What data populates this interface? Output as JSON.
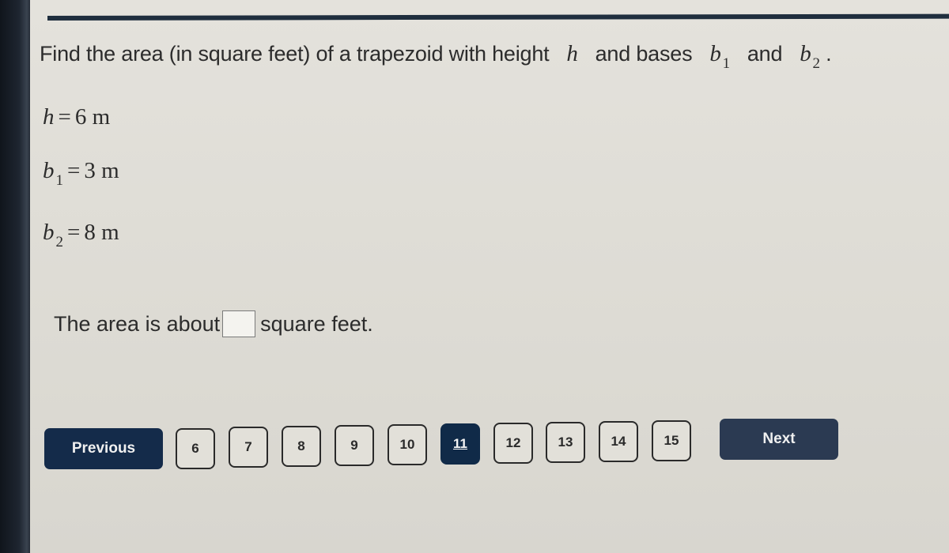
{
  "question": {
    "prefix": "Find the area (in square feet) of a trapezoid with height",
    "var_h": "h",
    "mid": "and bases",
    "var_b": "b",
    "sub_1": "1",
    "and": "and",
    "sub_2": "2",
    "end": "."
  },
  "given": {
    "h": {
      "var": "h",
      "sub": "",
      "eq": "=",
      "value": "6 m"
    },
    "b1": {
      "var": "b",
      "sub": "1",
      "eq": "=",
      "value": "3 m"
    },
    "b2": {
      "var": "b",
      "sub": "2",
      "eq": "=",
      "value": "8 m"
    }
  },
  "answer": {
    "prefix": "The area is about",
    "input_value": "",
    "suffix": "square feet."
  },
  "nav": {
    "previous_label": "Previous",
    "next_label": "Next",
    "pages": [
      "6",
      "7",
      "8",
      "9",
      "10",
      "11",
      "12",
      "13",
      "14",
      "15"
    ],
    "current_page": "11"
  },
  "colors": {
    "primary_dark": "#142b4a",
    "active_page": "#102a48",
    "rule": "#1f2e3e"
  }
}
